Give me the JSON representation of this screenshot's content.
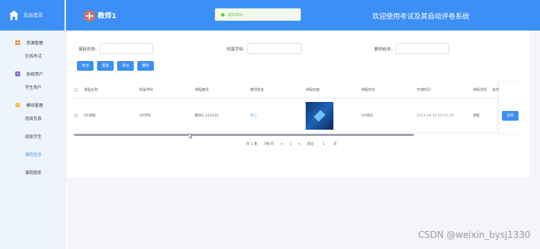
{
  "sidebar": {
    "home_label": "后台首页",
    "groups": [
      {
        "label": "资源管理",
        "icon": "grid-icon",
        "color": "#f0883e",
        "items": [
          "在线考试"
        ]
      },
      {
        "label": "系统用户",
        "icon": "user-icon",
        "color": "#8a63d2",
        "items": [
          "学生用户"
        ]
      },
      {
        "label": "模块管理",
        "icon": "dot-icon",
        "color": "#f3c43c",
        "items": [
          "班级信息",
          "班级学生",
          "课程信息",
          "课程题库"
        ]
      }
    ],
    "active_item": "课程信息"
  },
  "header": {
    "username": "教师1",
    "toast": "提交成功!",
    "system_title": "欢迎使用考试及其自动评卷系统"
  },
  "filters": {
    "course_name_label": "课程名称:",
    "subject_label": "所属学科:",
    "teacher_label": "教师姓名:"
  },
  "buttons": {
    "search": "查询",
    "reset": "重置",
    "add": "添加",
    "delete": "删除"
  },
  "table": {
    "columns": [
      "课程名称",
      "所属学科",
      "课程教师",
      "教师姓名",
      "课程封面",
      "课程地点",
      "开课时间",
      "课程详情",
      "操作"
    ],
    "rows": [
      {
        "course_name": "XX课程",
        "subject": "XX学科",
        "course_teacher": "教师1-112233",
        "teacher_name": "张三",
        "location": "XX地点",
        "start_time": "2023-04-14 09:25:29",
        "detail": "课程",
        "action": "详情"
      }
    ]
  },
  "pager": {
    "total": "共 1 条",
    "page_size": "7条/页",
    "prev": "<",
    "current": "1",
    "next": ">",
    "goto_label": "前往",
    "goto_value": "1",
    "page_suffix": "页"
  },
  "watermark": "CSDN @weixin_bysj1330",
  "colors": {
    "primary": "#3c8ff5",
    "success": "#67c23a"
  }
}
